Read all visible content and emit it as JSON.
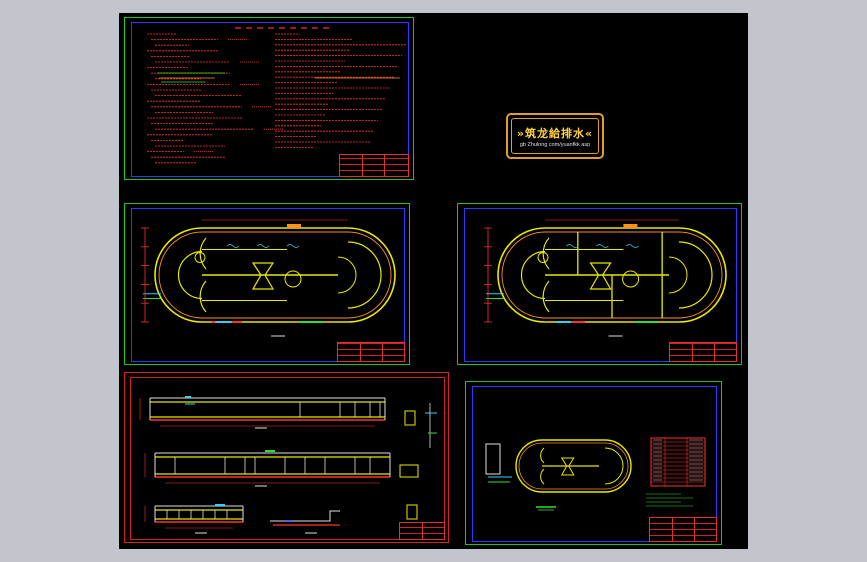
{
  "watermark": {
    "title": "»筑龙給排水«",
    "subtitle": "gb Zhulong com/yuanfkk asp"
  },
  "colors": {
    "background": "#c2c6cc",
    "canvas": "#000000",
    "frame_green": "#21c321",
    "frame_blue": "#2a3cff",
    "frame_red": "#d42020",
    "line_yellow": "#e8e800",
    "line_red": "#ff3030",
    "accent_gold": "#e0a020"
  },
  "sheets": [
    {
      "id": "notes-sheet",
      "content": "design-notes-text"
    },
    {
      "id": "plan-sheet-1",
      "content": "oxidation-ditch-plan"
    },
    {
      "id": "plan-sheet-2",
      "content": "oxidation-ditch-plan-partitioned"
    },
    {
      "id": "section-sheet",
      "content": "longitudinal-sections"
    },
    {
      "id": "layout-sheet",
      "content": "overall-layout-with-table"
    }
  ]
}
